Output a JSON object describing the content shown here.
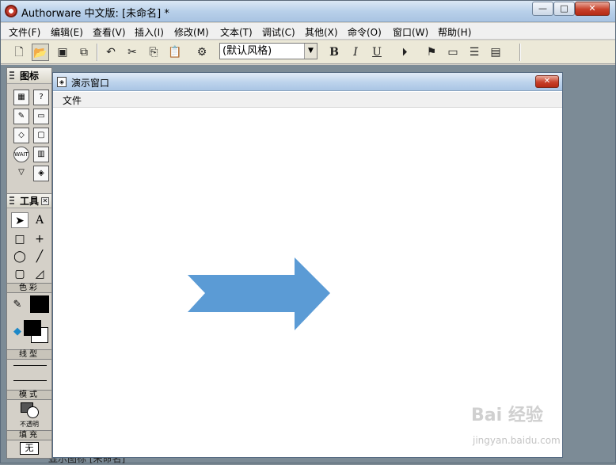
{
  "app": {
    "title": "Authorware 中文版: [未命名] *",
    "window_buttons": {
      "minimize": "—",
      "maximize": "□",
      "close": "✕"
    }
  },
  "menu": [
    {
      "label": "文件(F)"
    },
    {
      "label": "编辑(E)"
    },
    {
      "label": "查看(V)"
    },
    {
      "label": "插入(I)"
    },
    {
      "label": "修改(M)"
    },
    {
      "label": "文本(T)"
    },
    {
      "label": "调试(C)"
    },
    {
      "label": "其他(X)"
    },
    {
      "label": "命令(O)"
    },
    {
      "label": "窗口(W)"
    },
    {
      "label": "帮助(H)"
    }
  ],
  "toolbar": {
    "style_select_value": "(默认风格)",
    "bold": "B",
    "italic": "I",
    "underline": "U"
  },
  "icon_palette": {
    "title": "图标"
  },
  "tools_palette": {
    "title": "工具",
    "text_tool": "A",
    "sections": {
      "color": "色彩",
      "line": "线型",
      "mode": "模式",
      "fill": "填充"
    },
    "mode_value": "不透明",
    "fill_value": "无"
  },
  "presentation_window": {
    "title": "演示窗口",
    "menu_file": "文件",
    "arrow_color": "#5b9bd5"
  },
  "status_behind": "显示图标 [未命名]",
  "watermark": {
    "main": "Bai 经验",
    "sub": "jingyan.baidu.com"
  }
}
